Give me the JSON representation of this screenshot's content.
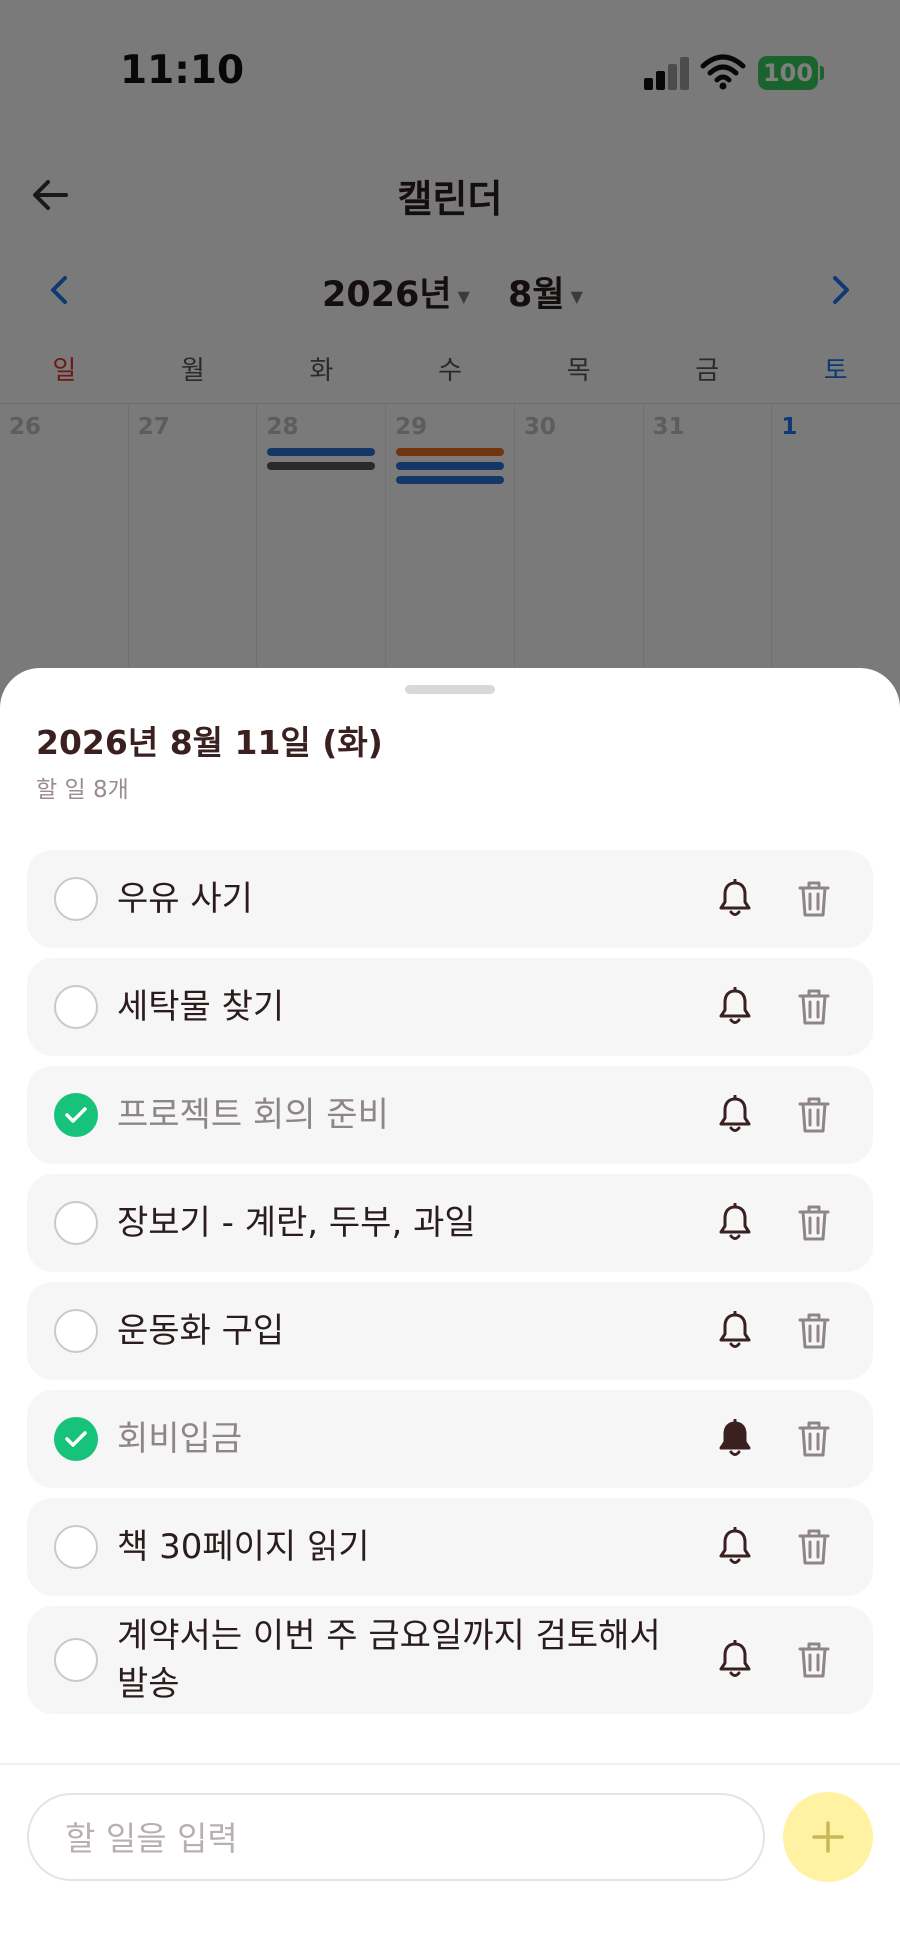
{
  "status_bar": {
    "time": "11:10",
    "battery": "100"
  },
  "header": {
    "title": "캘린더"
  },
  "calendar": {
    "year": "2026년",
    "month": "8월",
    "weekdays": [
      "일",
      "월",
      "화",
      "수",
      "목",
      "금",
      "토"
    ],
    "days": [
      "26",
      "27",
      "28",
      "29",
      "30",
      "31",
      "1"
    ]
  },
  "sheet": {
    "date_title": "2026년 8월 11일 (화)",
    "count_label": "할 일 8개",
    "todos": [
      {
        "text": "우유 사기",
        "done": false,
        "alarm_on": false
      },
      {
        "text": "세탁물 찾기",
        "done": false,
        "alarm_on": false
      },
      {
        "text": "프로젝트 회의 준비",
        "done": true,
        "alarm_on": false
      },
      {
        "text": "장보기 - 계란, 두부, 과일",
        "done": false,
        "alarm_on": false
      },
      {
        "text": "운동화 구입",
        "done": false,
        "alarm_on": false
      },
      {
        "text": "회비입금",
        "done": true,
        "alarm_on": true
      },
      {
        "text": "책 30페이지 읽기",
        "done": false,
        "alarm_on": false
      },
      {
        "text": "계약서는 이번 주 금요일까지 검토해서 발송",
        "done": false,
        "alarm_on": false
      }
    ],
    "input_placeholder": "할 일을 입력"
  },
  "colors": {
    "done_check": "#17c37b",
    "add_button": "#fff3a3",
    "event_blue": "#2a6fd0",
    "event_gray": "#555555",
    "event_orange": "#e06a1c"
  }
}
